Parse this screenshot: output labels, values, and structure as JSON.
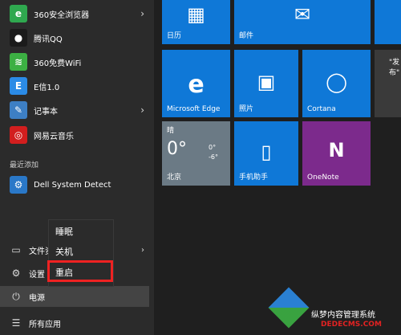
{
  "left_apps": [
    {
      "label": "360安全浏览器",
      "icon": "browser-360-icon",
      "color": "#2fa84f",
      "glyph": "e",
      "has_arrow": true
    },
    {
      "label": "腾讯QQ",
      "icon": "qq-icon",
      "color": "#1b1b1b",
      "glyph": "●",
      "has_arrow": false
    },
    {
      "label": "360免费WiFi",
      "icon": "wifi-360-icon",
      "color": "#3cb043",
      "glyph": "≋",
      "has_arrow": false
    },
    {
      "label": "E信1.0",
      "icon": "exin-icon",
      "color": "#2b8be6",
      "glyph": "E",
      "has_arrow": false
    },
    {
      "label": "记事本",
      "icon": "notepad-icon",
      "color": "#3d7fc4",
      "glyph": "✎",
      "has_arrow": true
    },
    {
      "label": "网易云音乐",
      "icon": "netease-music-icon",
      "color": "#d21e1e",
      "glyph": "◎",
      "has_arrow": false
    }
  ],
  "recent_header": "最近添加",
  "recent_app": {
    "label": "Dell System Detect",
    "icon": "dell-detect-icon",
    "color": "#2a78c8",
    "glyph": "⚙"
  },
  "tiles": {
    "calendar": {
      "label": "日历",
      "icon": "calendar-icon",
      "glyph": "▦"
    },
    "mail": {
      "label": "邮件",
      "icon": "mail-icon",
      "glyph": "✉"
    },
    "edge": {
      "label": "Microsoft Edge",
      "icon": "edge-icon",
      "glyph": "e"
    },
    "photos": {
      "label": "照片",
      "icon": "photos-icon",
      "glyph": "▣"
    },
    "cortana": {
      "label": "Cortana",
      "icon": "cortana-icon",
      "glyph": "◯"
    },
    "weather": {
      "condition": "晴",
      "temp": "0°",
      "high": "0°",
      "low": "-6°",
      "city": "北京"
    },
    "phone": {
      "label": "手机助手",
      "icon": "phone-assistant-icon",
      "glyph": "▯"
    },
    "onenote": {
      "label": "OneNote",
      "icon": "onenote-icon",
      "glyph": "N"
    },
    "news": {
      "label": "\"发布\"",
      "icon": "news-icon"
    }
  },
  "power_menu": {
    "sleep": "睡眠",
    "shutdown": "关机",
    "restart": "重启"
  },
  "bottom": {
    "files": "文件资",
    "settings": "设置",
    "power": "电源",
    "all_apps": "所有应用"
  },
  "watermark": {
    "line1": "纵梦内容管理系统",
    "line2": "DEDECMS.COM"
  },
  "colors": {
    "tile_blue": "#0f78d7",
    "tile_purple": "#7c2a8c",
    "highlight_red": "#e22222"
  }
}
